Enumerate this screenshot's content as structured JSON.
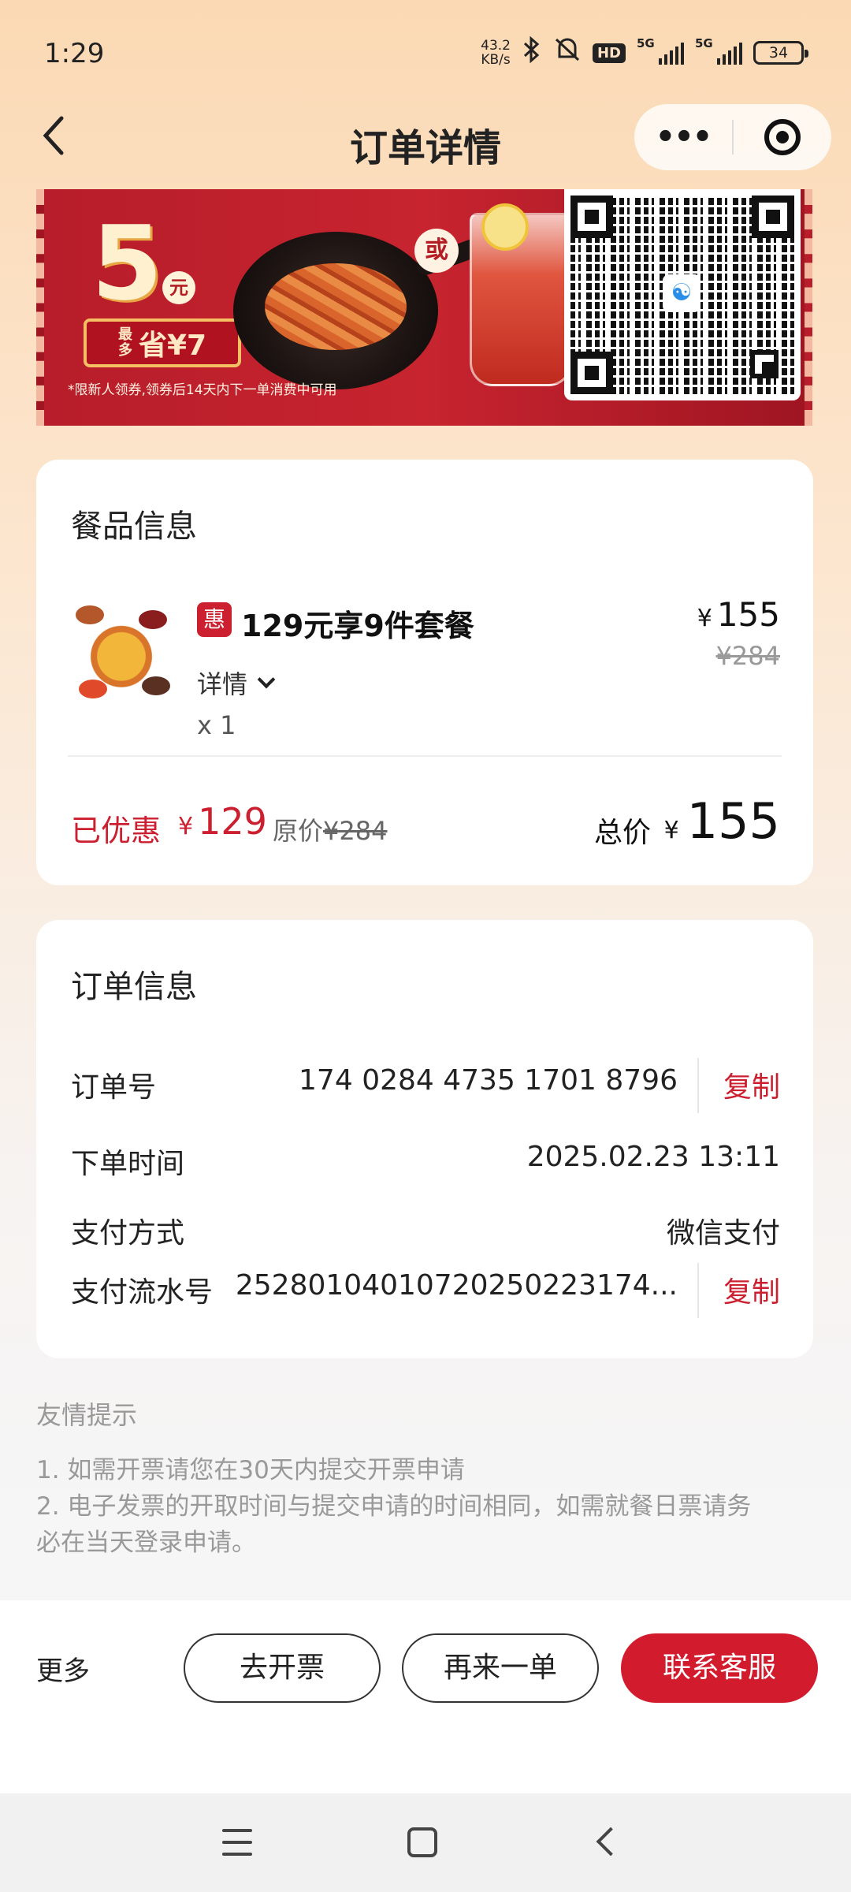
{
  "status_bar": {
    "time": "1:29",
    "net_speed_value": "43.2",
    "net_speed_unit": "KB/s",
    "hd_label": "HD",
    "signal1_label": "5G",
    "signal2_label": "5G",
    "battery": "34"
  },
  "nav": {
    "title": "订单详情",
    "more_glyph": "•••"
  },
  "banner": {
    "big_number": "5",
    "unit": "元",
    "save_prefix_top": "最",
    "save_prefix_bottom": "多",
    "save_text": "省¥7",
    "or_label": "或",
    "note": "*限新人领券,领券后14天内下一单消费中可用"
  },
  "product_card": {
    "title": "餐品信息",
    "item": {
      "tag": "惠",
      "name": "129元享9件套餐",
      "detail_label": "详情",
      "quantity": "x 1",
      "currency": "¥",
      "price": "155",
      "original_price": "¥284"
    },
    "summary": {
      "discount_label": "已优惠",
      "currency": "¥",
      "discount_amount": "129",
      "original_label": "原价",
      "original_value": "¥284",
      "total_label": "总价",
      "total_currency": "¥",
      "total_amount": "155"
    }
  },
  "order_card": {
    "title": "订单信息",
    "order_no_label": "订单号",
    "order_no_value": "174 0284 4735 1701 8796",
    "copy_label": "复制",
    "time_label": "下单时间",
    "time_value": "2025.02.23 13:11",
    "pay_method_label": "支付方式",
    "pay_method_value": "微信支付",
    "serial_label": "支付流水号",
    "serial_value": "25280104010720250223174..."
  },
  "tips": {
    "title": "友情提示",
    "lines": [
      "1. 如需开票请您在30天内提交开票申请",
      "2. 电子发票的开取时间与提交申请的时间相同，如需就餐日票请务",
      "必在当天登录申请。"
    ]
  },
  "bottom_bar": {
    "more_label": "更多",
    "invoice_label": "去开票",
    "reorder_label": "再来一单",
    "service_label": "联系客服"
  },
  "colors": {
    "accent": "#d21c2e",
    "price_red": "#cc1f2f",
    "bg_top": "#fbd9b4"
  }
}
